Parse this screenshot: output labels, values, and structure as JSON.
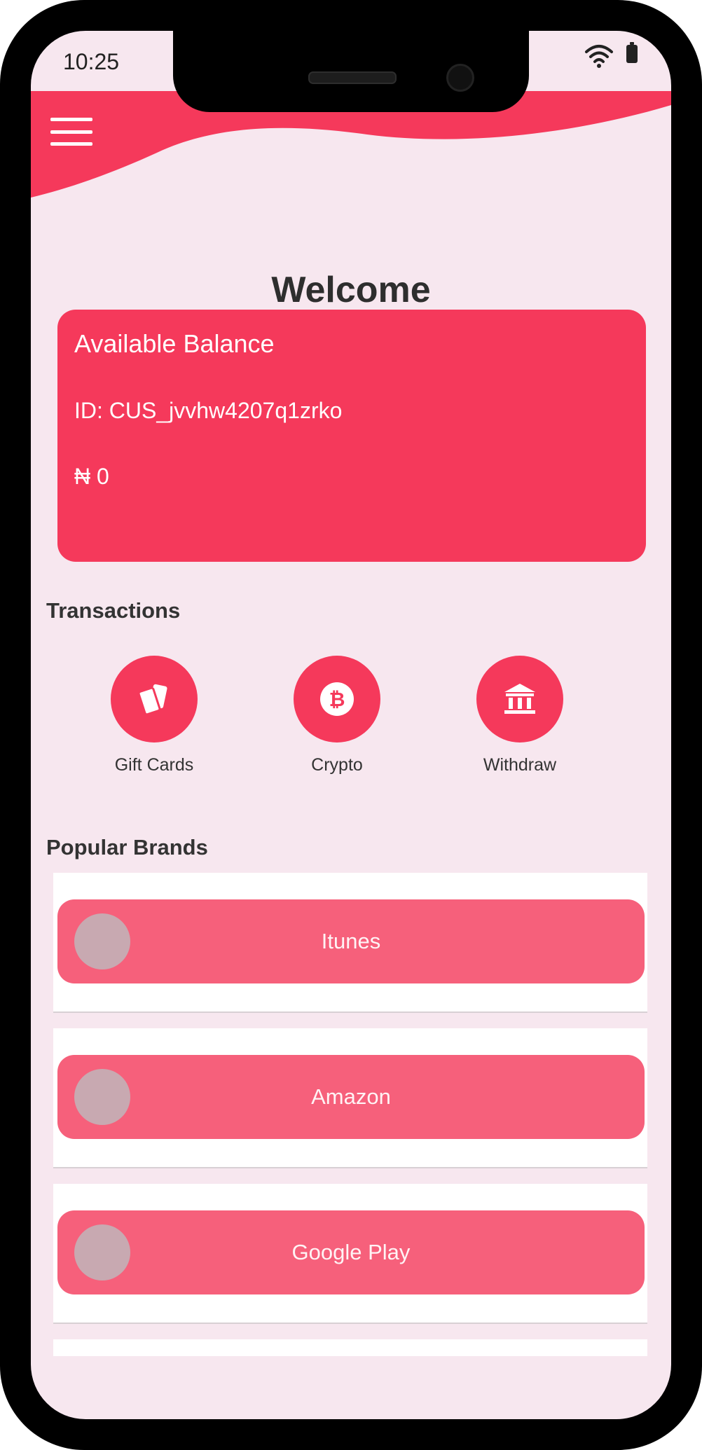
{
  "status_bar": {
    "time": "10:25"
  },
  "header": {
    "welcome": "Welcome",
    "accent_color": "#f5395b"
  },
  "balance_card": {
    "title": "Available Balance",
    "customer_id": "ID: CUS_jvvhw4207q1zrko",
    "amount": "₦ 0"
  },
  "transactions": {
    "title": "Transactions",
    "items": [
      {
        "label": "Gift Cards",
        "icon": "gift-cards-icon"
      },
      {
        "label": "Crypto",
        "icon": "bitcoin-icon"
      },
      {
        "label": "Withdraw",
        "icon": "bank-icon"
      }
    ]
  },
  "popular_brands": {
    "title": "Popular Brands",
    "items": [
      {
        "label": "Itunes"
      },
      {
        "label": "Amazon"
      },
      {
        "label": "Google Play"
      }
    ]
  }
}
